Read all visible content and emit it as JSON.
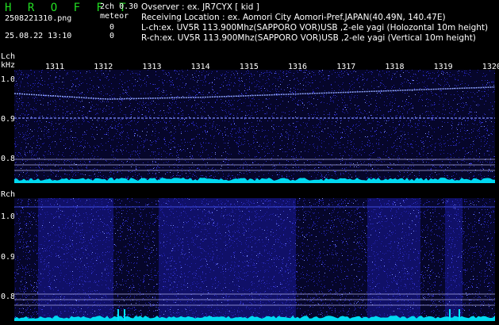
{
  "header": {
    "logo": "H R O F F T",
    "version": "2ch 0.30",
    "filename": "2508221310.png",
    "datetime": "25.08.22 13:10",
    "meteor_label": "meteor",
    "meteor_l": "0",
    "meteor_r": "0",
    "observer": "Ovserver            : ex. JR7CYX [ kid ]",
    "location": "Receiving Location : ex. Aomori City Aomori-Pref.JAPAN(40.49N, 140.47E)",
    "lch_info": "L-ch:ex. UV5R 113.900Mhz(SAPPORO VOR)USB ,2-ele yagi (Holozontal 10m height)",
    "rch_info": "R-ch:ex. UV5R 113.900Mhz(SAPPORO VOR)USB ,2-ele yagi (Vertical 10m height)"
  },
  "lch": {
    "label": "Lch",
    "unit": "kHz"
  },
  "rch": {
    "label": "Rch"
  },
  "time_ticks": [
    "1311",
    "1312",
    "1313",
    "1314",
    "1315",
    "1316",
    "1317",
    "1318",
    "1319",
    "1320"
  ],
  "freq_ticks": [
    "1.0",
    "0.9",
    "0.8"
  ],
  "colors": {
    "logo": "#22dd22",
    "background": "#000000",
    "noise": "#1a1aa0",
    "signal": "#9fb2ff",
    "level": "#00e5ff"
  }
}
